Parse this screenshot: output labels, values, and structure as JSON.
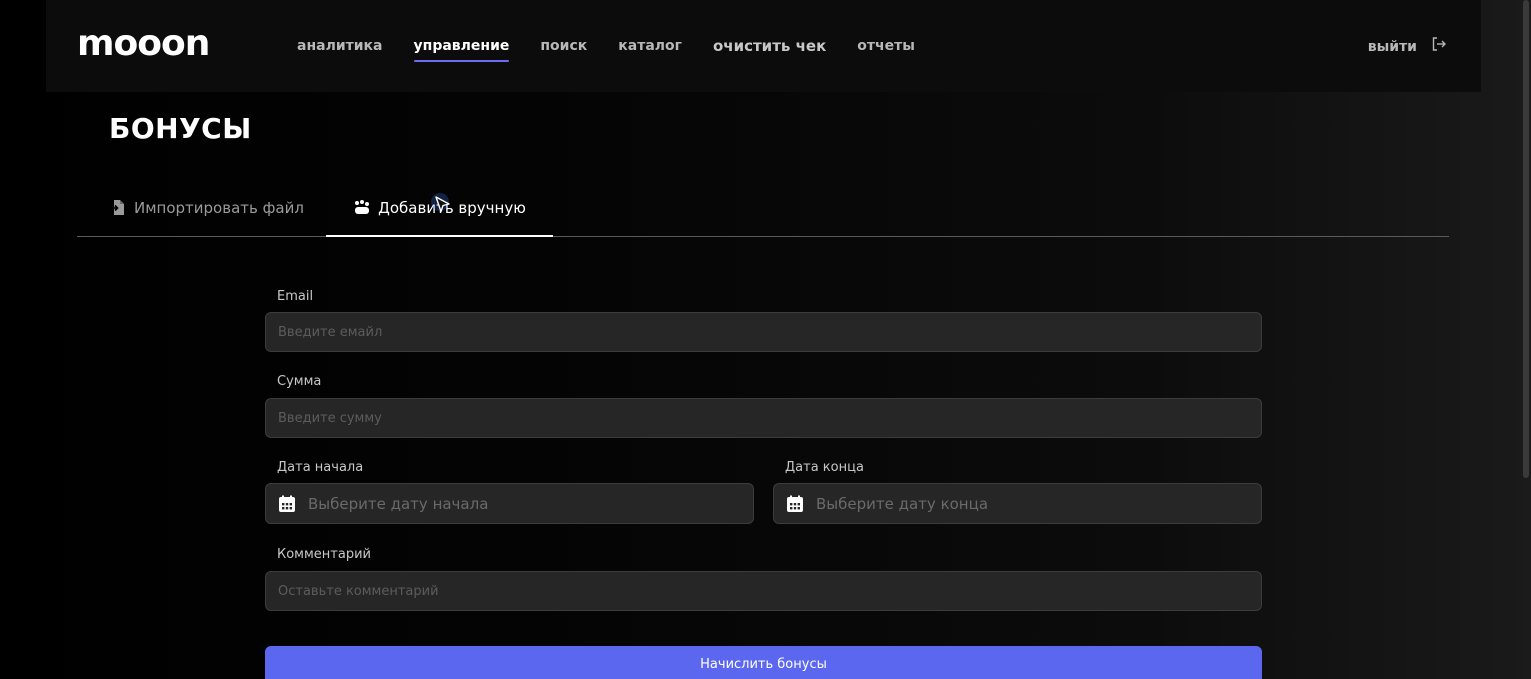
{
  "header": {
    "logo": "mooon",
    "nav": [
      {
        "label": "аналитика",
        "active": false
      },
      {
        "label": "управление",
        "active": true
      },
      {
        "label": "поиск",
        "active": false
      },
      {
        "label": "каталог",
        "active": false
      },
      {
        "label": "очистить чек",
        "active": false
      },
      {
        "label": "отчеты",
        "active": false
      }
    ],
    "logout_label": "выйти",
    "accent_color": "#6b6ef5"
  },
  "page": {
    "title": "БОНУСЫ"
  },
  "tabs": {
    "import_label": "Импортировать файл",
    "manual_label": "Добавить вручную",
    "active": "manual"
  },
  "form": {
    "email": {
      "label": "Email",
      "placeholder": "Введите емайл",
      "value": ""
    },
    "amount": {
      "label": "Сумма",
      "placeholder": "Введите сумму",
      "value": ""
    },
    "start_date": {
      "label": "Дата начала",
      "placeholder": "Выберите дату начала"
    },
    "end_date": {
      "label": "Дата конца",
      "placeholder": "Выберите дату конца"
    },
    "comment": {
      "label": "Комментарий",
      "placeholder": "Оставьте комментарий",
      "value": ""
    },
    "submit_label": "Начислить бонусы",
    "submit_color": "#5c67f0"
  },
  "icons": {
    "logout": "logout-icon",
    "import": "file-import-icon",
    "manual": "hand-add-icon",
    "calendar": "calendar-icon",
    "cursor": "mouse-pointer-icon"
  }
}
